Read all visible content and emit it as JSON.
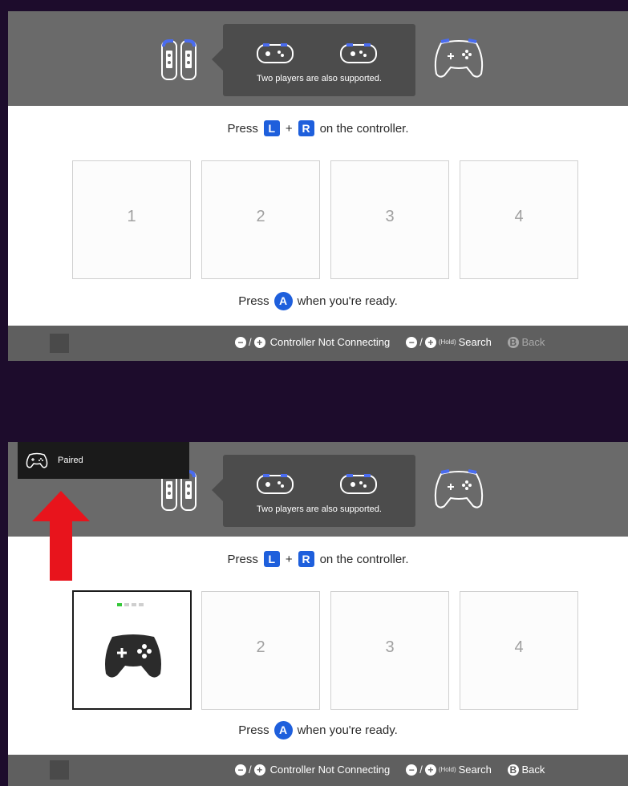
{
  "header": {
    "also_supported": "Two players are also supported."
  },
  "instruction": {
    "press": "Press",
    "l_button": "L",
    "plus": "+",
    "r_button": "R",
    "suffix": "on the controller."
  },
  "slots": [
    "1",
    "2",
    "3",
    "4"
  ],
  "ready": {
    "press": "Press",
    "a_button": "A",
    "suffix": "when you're ready."
  },
  "footer": {
    "not_connecting": "Controller Not Connecting",
    "hold": "(Hold)",
    "search": "Search",
    "b_button": "B",
    "back": "Back"
  },
  "toast": {
    "label": "Paired"
  },
  "player_indicator": {
    "lit_led": 1,
    "total_leds": 4
  },
  "colors": {
    "button_blue": "#1e5fdc",
    "led_green": "#35c83a",
    "arrow_red": "#e8141c",
    "background_purple": "#1d0c2c",
    "header_gray": "#6a6a6a",
    "footer_gray": "#5f5f5f"
  }
}
